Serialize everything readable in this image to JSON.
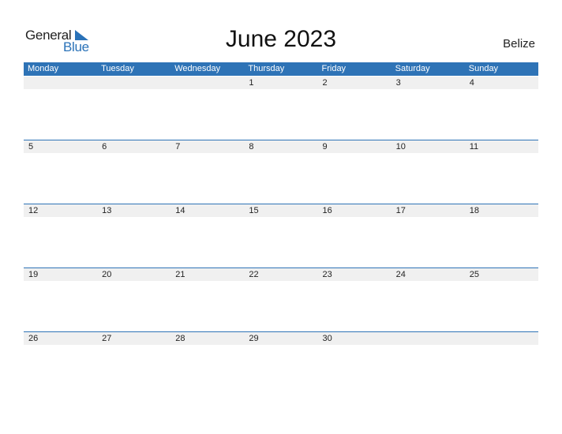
{
  "logo": {
    "general": "General",
    "blue": "Blue"
  },
  "title": "June 2023",
  "country": "Belize",
  "colors": {
    "accent": "#2e73b6",
    "date_strip": "#f0f0f0"
  },
  "weekdays": [
    "Monday",
    "Tuesday",
    "Wednesday",
    "Thursday",
    "Friday",
    "Saturday",
    "Sunday"
  ],
  "weeks": [
    [
      "",
      "",
      "",
      "1",
      "2",
      "3",
      "4"
    ],
    [
      "5",
      "6",
      "7",
      "8",
      "9",
      "10",
      "11"
    ],
    [
      "12",
      "13",
      "14",
      "15",
      "16",
      "17",
      "18"
    ],
    [
      "19",
      "20",
      "21",
      "22",
      "23",
      "24",
      "25"
    ],
    [
      "26",
      "27",
      "28",
      "29",
      "30",
      "",
      ""
    ]
  ]
}
